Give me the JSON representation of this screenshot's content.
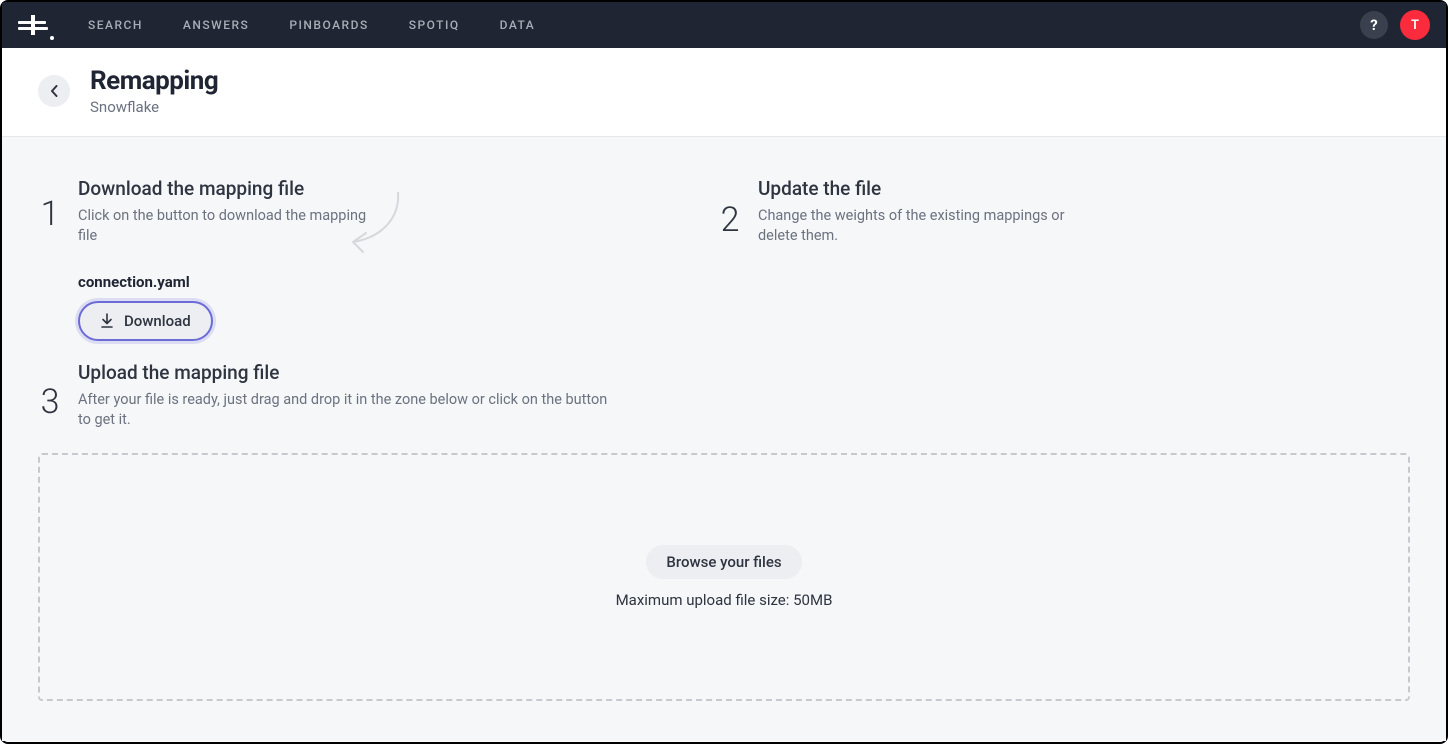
{
  "nav": {
    "items": [
      "SEARCH",
      "ANSWERS",
      "PINBOARDS",
      "SPOTIQ",
      "DATA"
    ],
    "help": "?",
    "avatar": "T"
  },
  "page": {
    "title": "Remapping",
    "subtitle": "Snowflake"
  },
  "steps": {
    "s1": {
      "num": "1",
      "title": "Download the mapping file",
      "desc": "Click on the button to download the mapping file",
      "filename": "connection.yaml",
      "download_label": "Download"
    },
    "s2": {
      "num": "2",
      "title": "Update the file",
      "desc": "Change the weights of the existing mappings or delete them."
    },
    "s3": {
      "num": "3",
      "title": "Upload the mapping file",
      "desc": "After your file is ready, just drag and drop it in the zone below or click on the button to get it."
    }
  },
  "dropzone": {
    "browse_label": "Browse your files",
    "max_text": "Maximum upload file size: 50MB"
  }
}
